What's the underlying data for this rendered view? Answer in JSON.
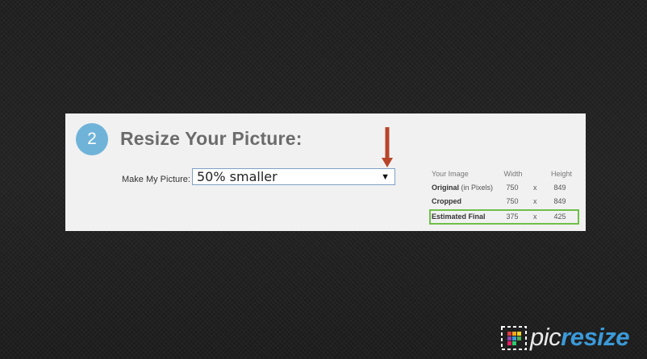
{
  "step": {
    "number": "2",
    "title": "Resize Your Picture:"
  },
  "resize": {
    "label": "Make My Picture:",
    "selected": "50% smaller"
  },
  "info": {
    "header": {
      "label": "Your Image",
      "width": "Width",
      "height": "Height"
    },
    "rows": [
      {
        "label_bold": "Original",
        "label_extra": " (in Pixels)",
        "width": "750",
        "x": "x",
        "height": "849"
      },
      {
        "label_bold": "Cropped",
        "label_extra": "",
        "width": "750",
        "x": "x",
        "height": "849"
      },
      {
        "label_bold": "Estimated Final",
        "label_extra": "",
        "width": "375",
        "x": "x",
        "height": "425"
      }
    ]
  },
  "brand": {
    "part1": "pic",
    "part2": "resize"
  },
  "colors": {
    "accent_blue": "#6fb3d9",
    "arrow_red": "#b8452a",
    "final_border": "#6fbf4a",
    "brand_blue": "#3b9ad9"
  }
}
